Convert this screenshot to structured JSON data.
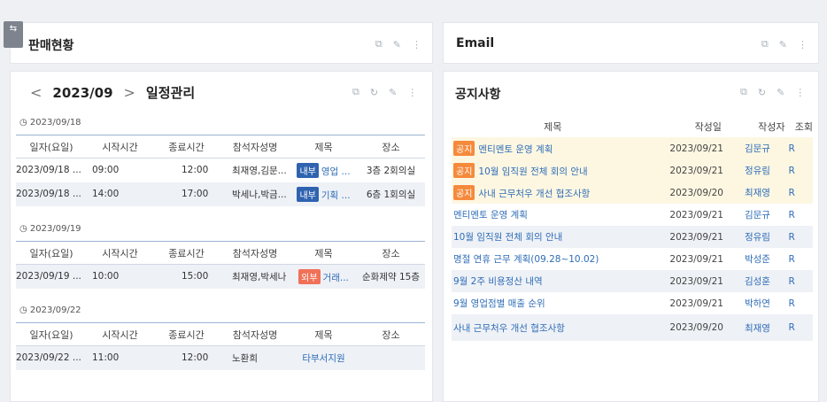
{
  "sidebar_toggle": {
    "icon": "swap-icon"
  },
  "sales": {
    "title": "판매현황"
  },
  "email": {
    "title": "Email"
  },
  "schedule": {
    "prev": "<",
    "month": "2023/09",
    "next": ">",
    "title": "일정관리",
    "columns": [
      "일자(요일)",
      "시작시간",
      "종료시간",
      "참석자성명",
      "제목",
      "장소"
    ],
    "groups": [
      {
        "date": "◷ 2023/09/18",
        "rows": [
          {
            "day": "2023/09/18 ...",
            "start": "09:00",
            "end": "12:00",
            "attendees": "최재영,김문...",
            "tag": "내부",
            "subject": "영업 ...",
            "place": "3층 2회의실"
          },
          {
            "day": "2023/09/18 ...",
            "start": "14:00",
            "end": "17:00",
            "attendees": "박세나,박금...",
            "tag": "내부",
            "subject": "기획 ...",
            "place": "6층 1회의실"
          }
        ]
      },
      {
        "date": "◷ 2023/09/19",
        "rows": [
          {
            "day": "2023/09/19 ...",
            "start": "10:00",
            "end": "15:00",
            "attendees": "최재영,박세나",
            "tag": "외부",
            "subject": "거래...",
            "place": "순화제약 15층"
          }
        ]
      },
      {
        "date": "◷ 2023/09/22",
        "rows": [
          {
            "day": "2023/09/22 ...",
            "start": "11:00",
            "end": "12:00",
            "attendees": "노환희",
            "tag": "",
            "subject": "타부서지원",
            "place": ""
          }
        ]
      }
    ]
  },
  "notices": {
    "title": "공지사항",
    "columns": [
      "제목",
      "작성일",
      "작성자",
      "조회"
    ],
    "tag_label": "공지",
    "rows": [
      {
        "title": "멘티멘토 운영 계획",
        "date": "2023/09/21",
        "author": "김문규",
        "view": "R"
      },
      {
        "title": "10월 임직원 전체 회의 안내",
        "date": "2023/09/21",
        "author": "정유림",
        "view": "R"
      },
      {
        "title": "사내 근무처우 개선 협조사항",
        "date": "2023/09/20",
        "author": "최재영",
        "view": "R"
      },
      {
        "title": "멘티멘토 운영 계획",
        "date": "2023/09/21",
        "author": "김문규",
        "view": "R"
      },
      {
        "title": "10월 임직원 전체 회의 안내",
        "date": "2023/09/21",
        "author": "정유림",
        "view": "R"
      },
      {
        "title": "명절 연휴 근무 계획(09.28~10.02)",
        "date": "2023/09/21",
        "author": "박성준",
        "view": "R"
      },
      {
        "title": "9월 2주 비용정산 내역",
        "date": "2023/09/21",
        "author": "김성훈",
        "view": "R"
      },
      {
        "title": "9월 영업점별 매출 순위",
        "date": "2023/09/21",
        "author": "박하연",
        "view": "R"
      },
      {
        "title": "사내 근무처우 개선 협조사항",
        "date": "2023/09/20",
        "author": "최재영",
        "view": "R"
      }
    ]
  },
  "tool_icons": {
    "popout": "⧉",
    "refresh": "↻",
    "edit": "✎",
    "more": "⋮"
  }
}
